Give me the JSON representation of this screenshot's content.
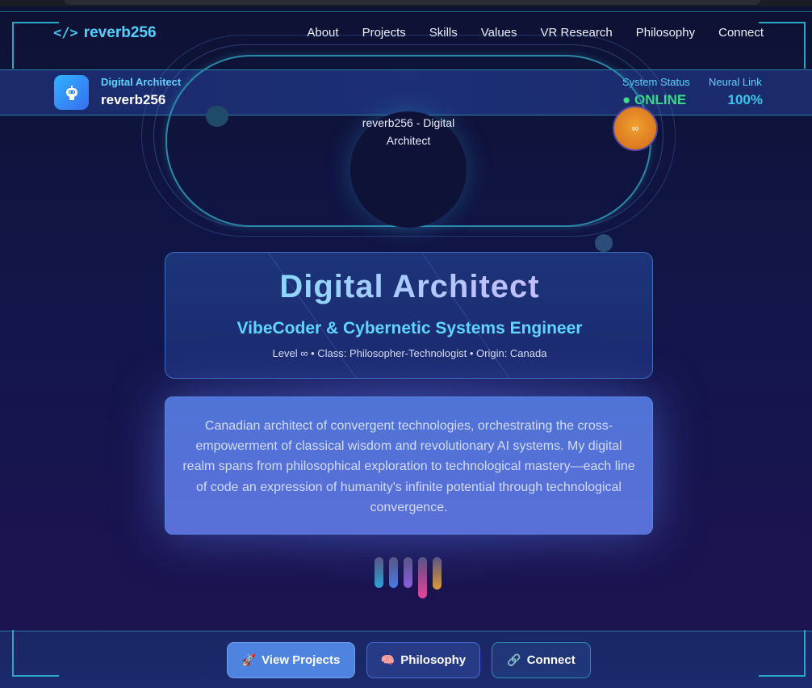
{
  "colors": {
    "accent_cyan": "#55d0ff",
    "online_green": "#3ed98a",
    "badge_orange": "#f0a030",
    "eq_bars": [
      "#2fa3d8",
      "#4b7be8",
      "#8a5fe0",
      "#e8449a",
      "#e09a3a"
    ]
  },
  "header": {
    "logo_icon": "code-icon",
    "logo_text": "reverb256",
    "nav": [
      "About",
      "Projects",
      "Skills",
      "Values",
      "VR Research",
      "Philosophy",
      "Connect"
    ]
  },
  "status_bar": {
    "avatar_icon": "robot-icon",
    "role": "Digital Architect",
    "name": "reverb256",
    "system_status_label": "System Status",
    "system_status_value": "● ONLINE",
    "neural_link_label": "Neural Link",
    "neural_link_value": "100%"
  },
  "orbit": {
    "core_label": "reverb256 - Digital Architect",
    "badge_text": "∞"
  },
  "hero": {
    "title": "Digital Architect",
    "subtitle": "VibeCoder & Cybernetic Systems Engineer",
    "meta": "Level ∞ • Class: Philosopher-Technologist • Origin: Canada"
  },
  "description": {
    "text": "Canadian architect of convergent technologies, orchestrating the cross-empowerment of classical wisdom and revolutionary AI systems. My digital realm spans from philosophical exploration to technological mastery—each line of code an expression of humanity's infinite potential through technological convergence."
  },
  "equalizer": {
    "levels": [
      0.68,
      0.68,
      0.68,
      0.91,
      0.72
    ]
  },
  "actions": {
    "view_projects": {
      "label": "View Projects",
      "icon": "rocket-icon"
    },
    "philosophy": {
      "label": "Philosophy",
      "icon": "brain-icon"
    },
    "connect": {
      "label": "Connect",
      "icon": "link-icon"
    }
  }
}
